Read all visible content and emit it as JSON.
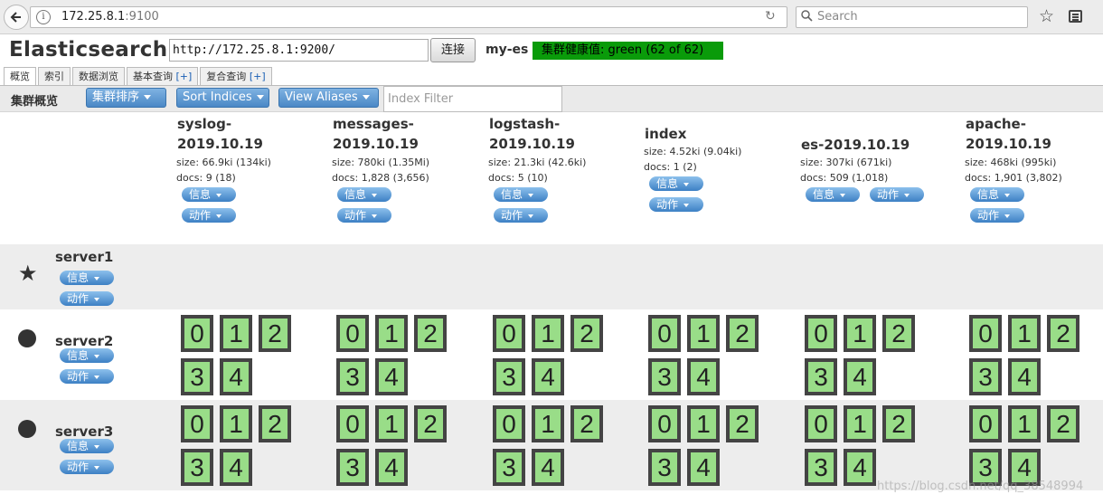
{
  "browser": {
    "url_host": "172.25.8.1",
    "url_port": ":9100",
    "search_placeholder": "Search"
  },
  "app": {
    "title": "Elasticsearch",
    "connect_url": "http://172.25.8.1:9200/",
    "connect_button": "连接",
    "cluster_name": "my-es",
    "health": "集群健康值: green (62 of 62)",
    "health_color": "#0a9b0a"
  },
  "tabs": [
    {
      "label": "概览",
      "plus": ""
    },
    {
      "label": "索引",
      "plus": ""
    },
    {
      "label": "数据浏览",
      "plus": ""
    },
    {
      "label": "基本查询 ",
      "plus": "[+]"
    },
    {
      "label": "复合查询 ",
      "plus": "[+]"
    }
  ],
  "toolbar": {
    "title": "集群概览",
    "sort_cluster": "集群排序",
    "sort_indices": "Sort Indices",
    "view_aliases": "View Aliases",
    "filter_placeholder": "Index Filter"
  },
  "pill_labels": {
    "info": "信息",
    "action": "动作"
  },
  "indices": [
    {
      "name": "syslog-2019.10.19",
      "size": "size: 66.9ki (134ki)",
      "docs": "docs: 9 (18)"
    },
    {
      "name": "messages-2019.10.19",
      "size": "size: 780ki (1.35Mi)",
      "docs": "docs: 1,828 (3,656)"
    },
    {
      "name": "logstash-2019.10.19",
      "size": "size: 21.3ki (42.6ki)",
      "docs": "docs: 5 (10)"
    },
    {
      "name": "index",
      "size": "size: 4.52ki (9.04ki)",
      "docs": "docs: 1 (2)"
    },
    {
      "name": "es-2019.10.19",
      "size": "size: 307ki (671ki)",
      "docs": "docs: 509 (1,018)"
    },
    {
      "name": "apache-2019.10.19",
      "size": "size: 468ki (995ki)",
      "docs": "docs: 1,901 (3,802)"
    }
  ],
  "servers": [
    {
      "name": "server1",
      "icon": "star-icon",
      "shards": []
    },
    {
      "name": "server2",
      "icon": "dot-icon",
      "shards": [
        "0",
        "1",
        "2",
        "3",
        "4"
      ]
    },
    {
      "name": "server3",
      "icon": "dot-icon",
      "shards": [
        "0",
        "1",
        "2",
        "3",
        "4"
      ]
    }
  ],
  "shard_color": "#99dd88",
  "watermark": "https://blog.csdn.net/qq_38548994"
}
